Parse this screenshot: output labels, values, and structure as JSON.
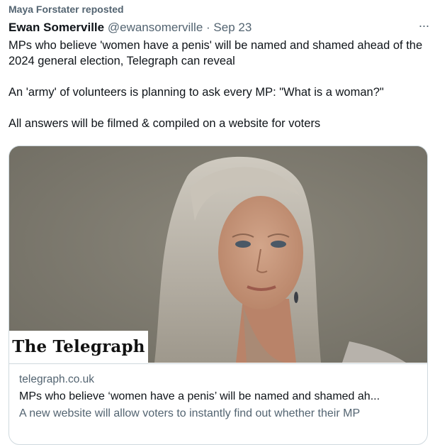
{
  "repost": {
    "label": "Maya Forstater reposted"
  },
  "tweet": {
    "author_name": "Ewan Somerville",
    "handle": "@ewansomerville",
    "separator": "·",
    "date": "Sep 23",
    "more_icon": "more-options-icon",
    "paragraphs": [
      "MPs who believe 'women have a penis' will be named and shamed ahead of the 2024 general election, Telegraph can reveal",
      "An 'army' of volunteers is planning to ask every MP: \"What is a woman?\"",
      "All answers will be filmed & compiled on a website for voters"
    ]
  },
  "card": {
    "brand": "The Telegraph",
    "domain": "telegraph.co.uk",
    "title": "MPs who believe ‘women have a penis’ will be named and shamed ah...",
    "description": "A new website will allow voters to instantly find out whether their MP"
  },
  "colors": {
    "text_primary": "#0f1419",
    "text_secondary": "#536471",
    "border": "#cfd9de"
  }
}
